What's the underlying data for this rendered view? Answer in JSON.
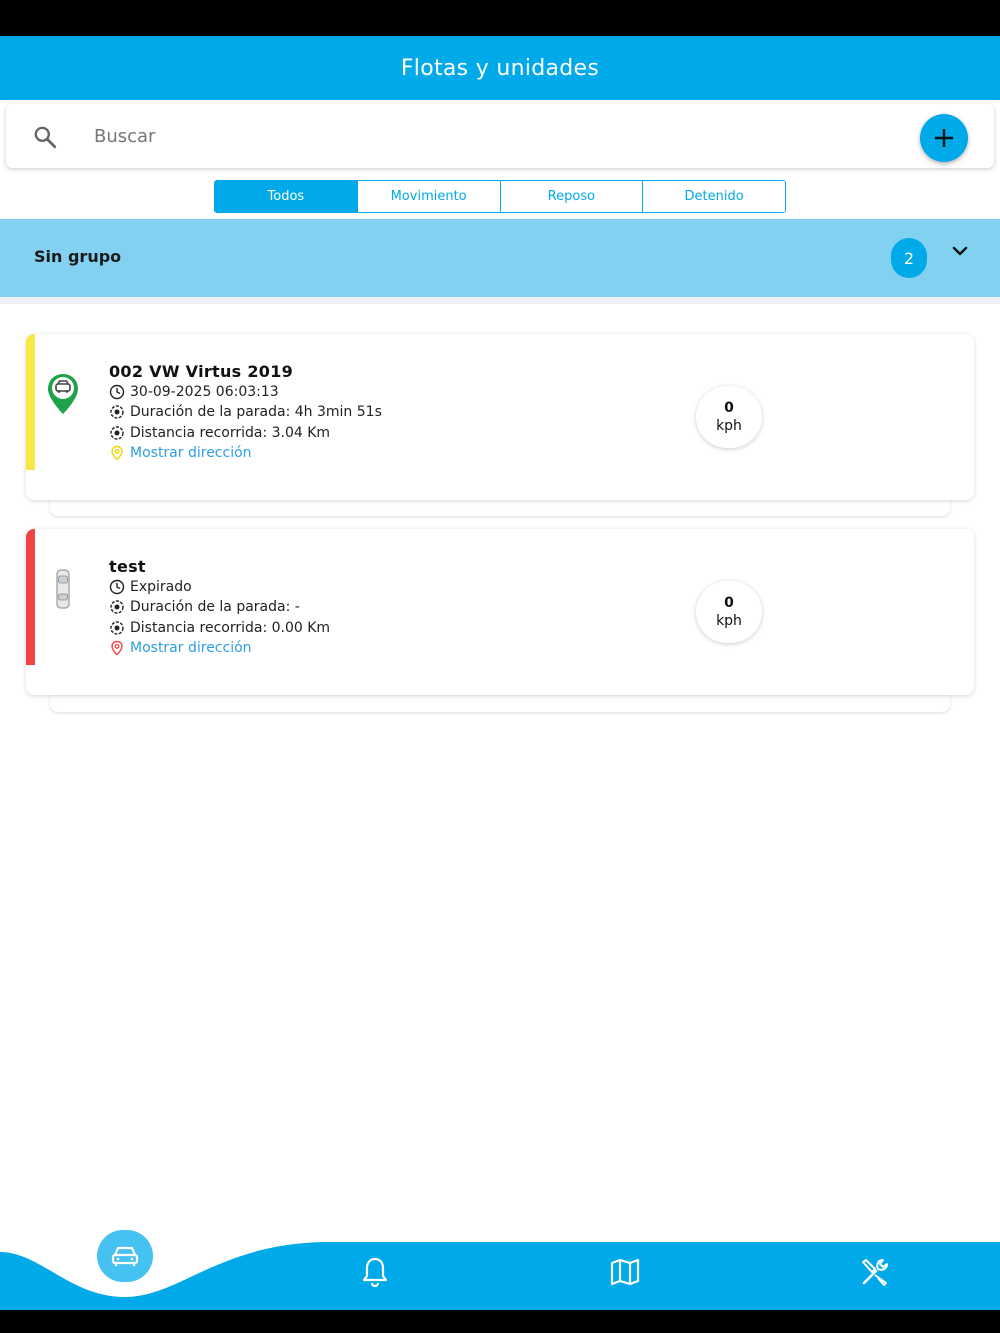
{
  "header": {
    "title": "Flotas y unidades"
  },
  "search": {
    "placeholder": "Buscar"
  },
  "filters": [
    {
      "label": "Todos",
      "active": true
    },
    {
      "label": "Movimiento",
      "active": false
    },
    {
      "label": "Reposo",
      "active": false
    },
    {
      "label": "Detenido",
      "active": false
    }
  ],
  "group": {
    "title": "Sin grupo",
    "count": "2"
  },
  "units": [
    {
      "name": "002 VW Virtus 2019",
      "status_color": "#f7e843",
      "icon": "green-map-pin-car-icon",
      "time": "30-09-2025 06:03:13",
      "stop_duration": "Duración de la parada: 4h 3min 51s",
      "distance": "Distancia recorrida: 3.04 Km",
      "address_link": "Mostrar dirección",
      "address_icon_color": "#f2d600",
      "speed": {
        "value": "0",
        "unit": "kph"
      }
    },
    {
      "name": "test",
      "status_color": "#ef4444",
      "icon": "car-top-view-icon",
      "time": "Expirado",
      "stop_duration": "Duración de la parada: -",
      "distance": "Distancia recorrida: 0.00 Km",
      "address_link": "Mostrar dirección",
      "address_icon_color": "#ef4444",
      "speed": {
        "value": "0",
        "unit": "kph"
      }
    }
  ],
  "nav": {
    "items": [
      "car-icon",
      "bell-icon",
      "map-icon",
      "tools-icon"
    ],
    "accent": "#00a9e8"
  }
}
